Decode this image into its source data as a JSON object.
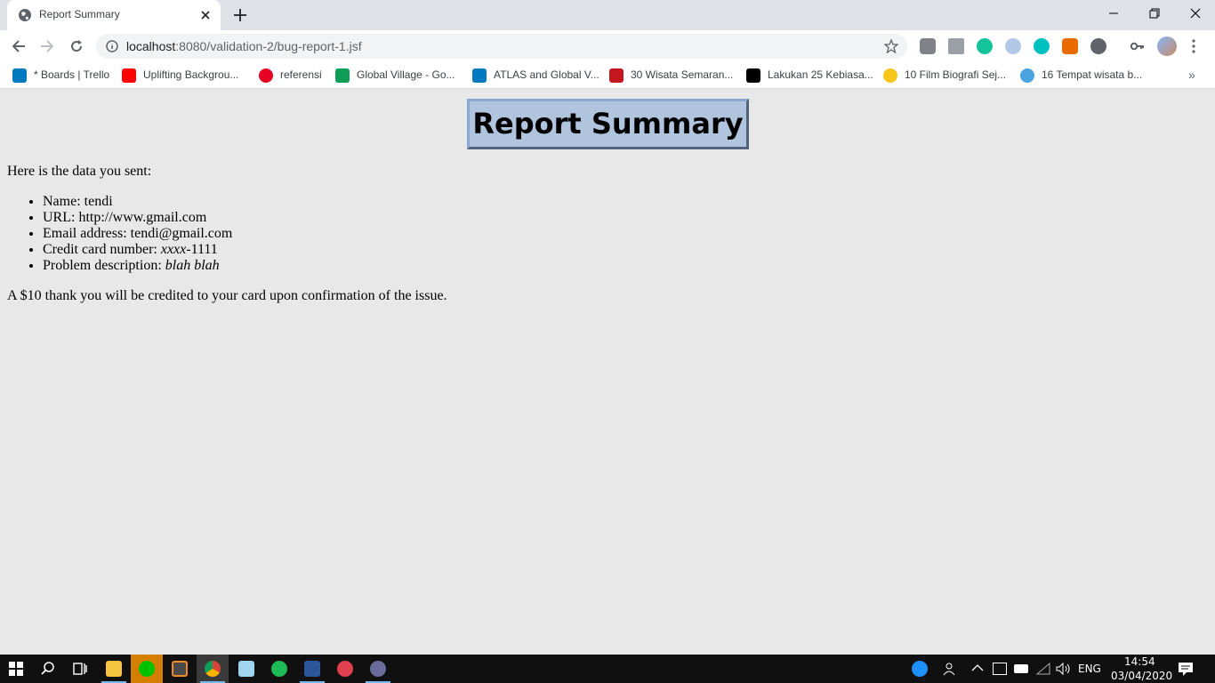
{
  "browser": {
    "tab": {
      "title": "Report Summary",
      "favicon": "globe-icon"
    },
    "address": {
      "host": "localhost",
      "rest": ":8080/validation-2/bug-report-1.jsf"
    },
    "bookmarks": [
      {
        "label": "* Boards | Trello",
        "icon": "trello-icon",
        "color": "#0079bf"
      },
      {
        "label": "Uplifting Backgrou...",
        "icon": "youtube-icon",
        "color": "#ff0000"
      },
      {
        "label": "referensi",
        "icon": "pinterest-icon",
        "color": "#e60023"
      },
      {
        "label": "Global Village - Go...",
        "icon": "google-drive-icon",
        "color": "#0f9d58"
      },
      {
        "label": "ATLAS and Global V...",
        "icon": "trello-icon",
        "color": "#0079bf"
      },
      {
        "label": "30 Wisata Semaran...",
        "icon": "m-icon",
        "color": "#c4161c"
      },
      {
        "label": "Lakukan 25 Kebiasa...",
        "icon": "medium-icon",
        "color": "#000000"
      },
      {
        "label": "10 Film Biografi Sej...",
        "icon": "z-icon",
        "color": "#f5c518"
      },
      {
        "label": "16 Tempat wisata b...",
        "icon": "bird-icon",
        "color": "#4aa3df"
      }
    ]
  },
  "page": {
    "heading": "Report Summary",
    "intro": "Here is the data you sent:",
    "items": {
      "name_label": "Name: ",
      "name_value": "tendi",
      "url_label": "URL: ",
      "url_value": "http://www.gmail.com",
      "email_label": "Email address: ",
      "email_value": "tendi@gmail.com",
      "card_label": "Credit card number: ",
      "card_masked": "xxxx",
      "card_suffix": "-1111",
      "desc_label": "Problem description: ",
      "desc_value": "blah blah"
    },
    "outro": "A $10 thank you will be credited to your card upon confirmation of the issue."
  },
  "taskbar": {
    "language": "ENG",
    "time": "14:54",
    "date": "03/04/2020"
  }
}
